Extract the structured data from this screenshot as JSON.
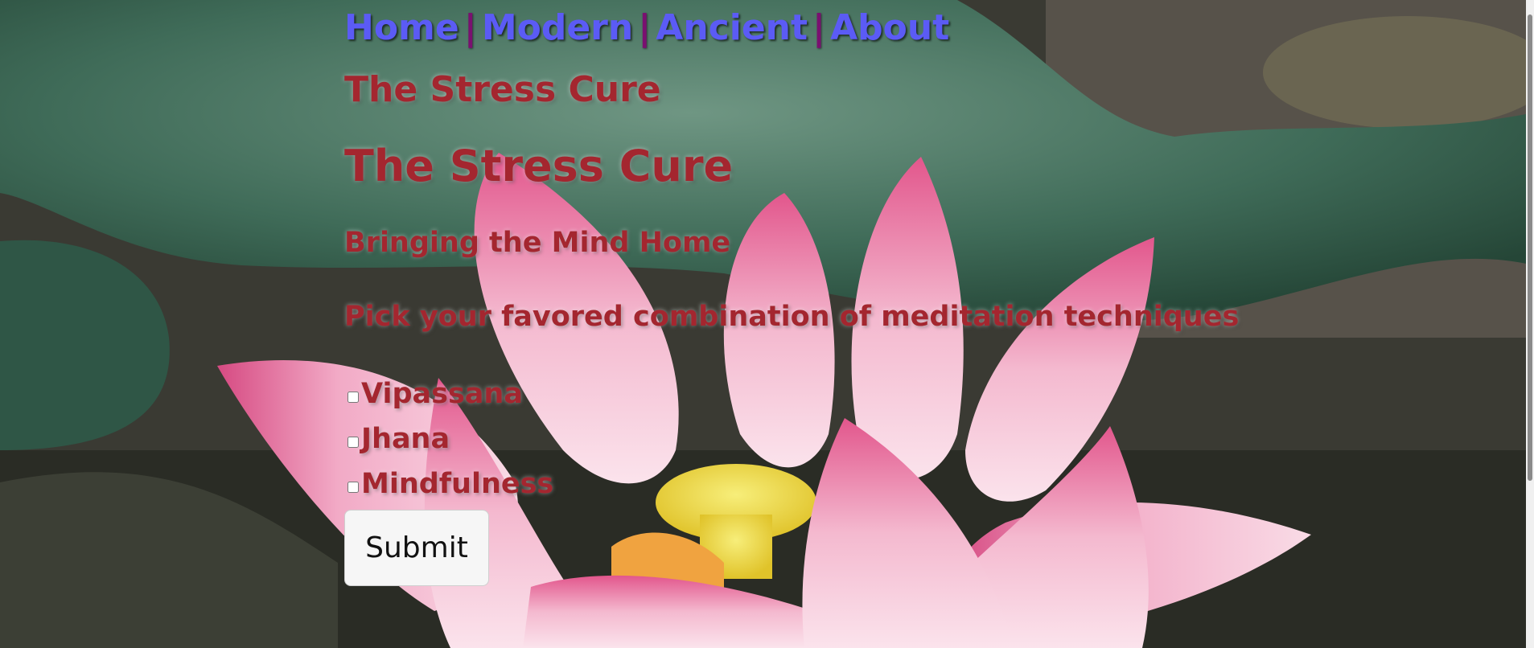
{
  "nav": {
    "home": "Home",
    "modern": "Modern",
    "ancient": "Ancient",
    "about": "About",
    "separator": "|"
  },
  "site_title": "The Stress Cure",
  "heading": "The Stress Cure",
  "subheading": "Bringing the Mind Home",
  "prompt": "Pick your favored combination of meditation techniques",
  "options": [
    {
      "label": "Vipassana",
      "checked": false
    },
    {
      "label": "Jhana",
      "checked": false
    },
    {
      "label": "Mindfulness",
      "checked": false
    }
  ],
  "submit_label": "Submit",
  "colors": {
    "text": "#a4262f",
    "link": "#5b5bf5",
    "separator": "#7a1070"
  }
}
